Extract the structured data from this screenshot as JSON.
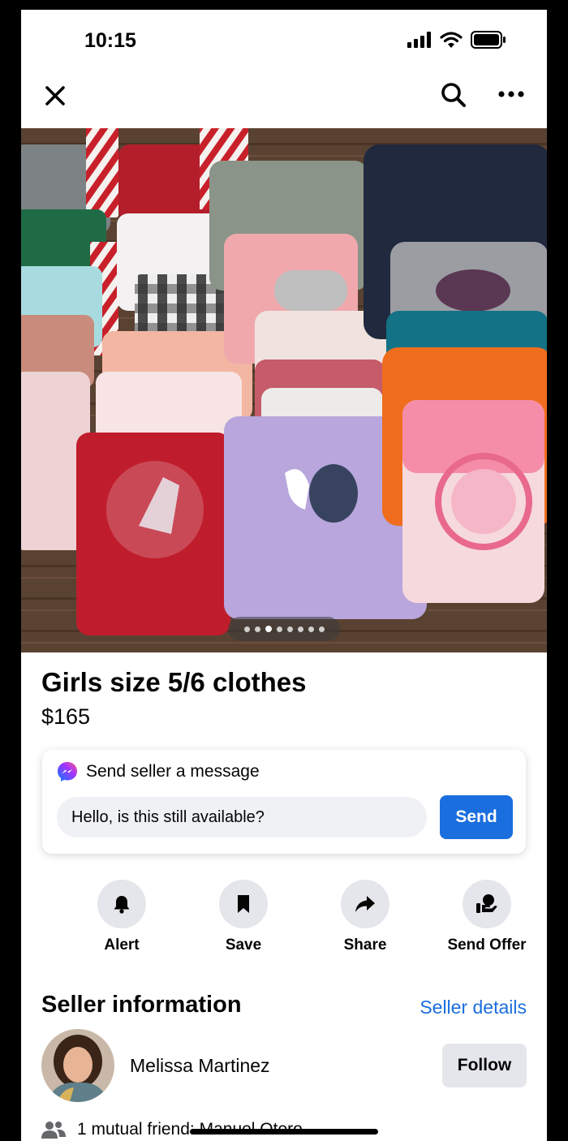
{
  "status_bar": {
    "time": "10:15"
  },
  "listing": {
    "title": "Girls size 5/6 clothes",
    "price": "$165",
    "photo_count": 8,
    "current_photo": 3
  },
  "message": {
    "header": "Send seller a message",
    "input_value": "Hello, is this still available?",
    "send_label": "Send"
  },
  "actions": [
    {
      "label": "Alert",
      "icon": "bell-icon"
    },
    {
      "label": "Save",
      "icon": "bookmark-icon"
    },
    {
      "label": "Share",
      "icon": "share-arrow-icon"
    },
    {
      "label": "Send Offer",
      "icon": "offer-icon"
    }
  ],
  "seller": {
    "section_title": "Seller information",
    "details_link": "Seller details",
    "name": "Melissa Martinez",
    "follow_label": "Follow",
    "mutual_prefix": "1 mutual friend: ",
    "mutual_name": "Manuel Otero"
  },
  "colors": {
    "accent": "#1a6ede",
    "button_grey": "#e4e6eb",
    "input_bg": "#eff1f4"
  }
}
